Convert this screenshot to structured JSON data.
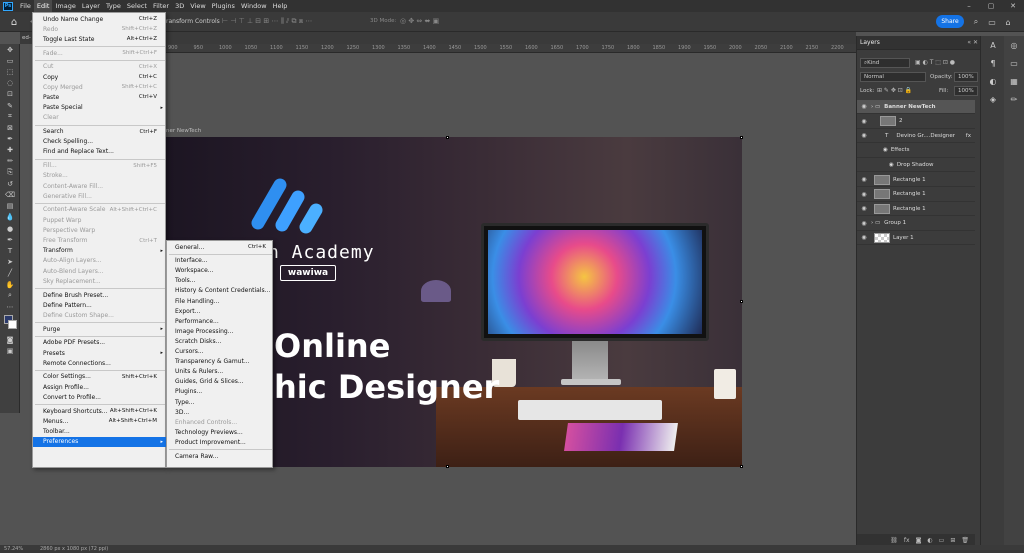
{
  "menubar": {
    "logo": "Ps",
    "items": [
      "File",
      "Edit",
      "Image",
      "Layer",
      "Type",
      "Select",
      "Filter",
      "3D",
      "View",
      "Plugins",
      "Window",
      "Help"
    ],
    "active": "Edit"
  },
  "options": {
    "transform_controls": "ransform Controls",
    "mode_3d": "3D Mode:",
    "share": "Share"
  },
  "doc_tab_label": "ed-",
  "ruler_ticks": [
    "900",
    "950",
    "1000",
    "1050",
    "1100",
    "1150",
    "1200",
    "1250",
    "1300",
    "1350",
    "1400",
    "1450",
    "1500",
    "1550",
    "1600",
    "1650",
    "1700",
    "1750",
    "1800",
    "1850",
    "1900",
    "1950",
    "2000",
    "2050",
    "2100",
    "2150",
    "2200"
  ],
  "edit_menu": [
    {
      "label": "Undo Name Change",
      "shortcut": "Ctrl+Z",
      "disabled": false
    },
    {
      "label": "Redo",
      "shortcut": "Shift+Ctrl+Z",
      "disabled": true
    },
    {
      "label": "Toggle Last State",
      "shortcut": "Alt+Ctrl+Z",
      "disabled": false
    },
    {
      "sep": true
    },
    {
      "label": "Fade...",
      "shortcut": "Shift+Ctrl+F",
      "disabled": true
    },
    {
      "sep": true
    },
    {
      "label": "Cut",
      "shortcut": "Ctrl+X",
      "disabled": true
    },
    {
      "label": "Copy",
      "shortcut": "Ctrl+C",
      "disabled": false
    },
    {
      "label": "Copy Merged",
      "shortcut": "Shift+Ctrl+C",
      "disabled": true
    },
    {
      "label": "Paste",
      "shortcut": "Ctrl+V",
      "disabled": false
    },
    {
      "label": "Paste Special",
      "shortcut": "",
      "disabled": false,
      "sub": true
    },
    {
      "label": "Clear",
      "shortcut": "",
      "disabled": true
    },
    {
      "sep": true
    },
    {
      "label": "Search",
      "shortcut": "Ctrl+F",
      "disabled": false
    },
    {
      "label": "Check Spelling...",
      "shortcut": "",
      "disabled": false
    },
    {
      "label": "Find and Replace Text...",
      "shortcut": "",
      "disabled": false
    },
    {
      "sep": true
    },
    {
      "label": "Fill...",
      "shortcut": "Shift+F5",
      "disabled": true
    },
    {
      "label": "Stroke...",
      "shortcut": "",
      "disabled": true
    },
    {
      "label": "Content-Aware Fill...",
      "shortcut": "",
      "disabled": true
    },
    {
      "label": "Generative Fill...",
      "shortcut": "",
      "disabled": true
    },
    {
      "sep": true
    },
    {
      "label": "Content-Aware Scale",
      "shortcut": "Alt+Shift+Ctrl+C",
      "disabled": true
    },
    {
      "label": "Puppet Warp",
      "shortcut": "",
      "disabled": true
    },
    {
      "label": "Perspective Warp",
      "shortcut": "",
      "disabled": true
    },
    {
      "label": "Free Transform",
      "shortcut": "Ctrl+T",
      "disabled": true
    },
    {
      "label": "Transform",
      "shortcut": "",
      "disabled": false,
      "sub": true
    },
    {
      "label": "Auto-Align Layers...",
      "shortcut": "",
      "disabled": true
    },
    {
      "label": "Auto-Blend Layers...",
      "shortcut": "",
      "disabled": true
    },
    {
      "label": "Sky Replacement...",
      "shortcut": "",
      "disabled": true
    },
    {
      "sep": true
    },
    {
      "label": "Define Brush Preset...",
      "shortcut": "",
      "disabled": false
    },
    {
      "label": "Define Pattern...",
      "shortcut": "",
      "disabled": false
    },
    {
      "label": "Define Custom Shape...",
      "shortcut": "",
      "disabled": true
    },
    {
      "sep": true
    },
    {
      "label": "Purge",
      "shortcut": "",
      "disabled": false,
      "sub": true
    },
    {
      "sep": true
    },
    {
      "label": "Adobe PDF Presets...",
      "shortcut": "",
      "disabled": false
    },
    {
      "label": "Presets",
      "shortcut": "",
      "disabled": false,
      "sub": true
    },
    {
      "label": "Remote Connections...",
      "shortcut": "",
      "disabled": false
    },
    {
      "sep": true
    },
    {
      "label": "Color Settings...",
      "shortcut": "Shift+Ctrl+K",
      "disabled": false
    },
    {
      "label": "Assign Profile...",
      "shortcut": "",
      "disabled": false
    },
    {
      "label": "Convert to Profile...",
      "shortcut": "",
      "disabled": false
    },
    {
      "sep": true
    },
    {
      "label": "Keyboard Shortcuts...",
      "shortcut": "Alt+Shift+Ctrl+K",
      "disabled": false
    },
    {
      "label": "Menus...",
      "shortcut": "Alt+Shift+Ctrl+M",
      "disabled": false
    },
    {
      "label": "Toolbar...",
      "shortcut": "",
      "disabled": false
    },
    {
      "label": "Preferences",
      "shortcut": "",
      "disabled": false,
      "sub": true,
      "highlight": true
    }
  ],
  "prefs_menu": [
    {
      "label": "General...",
      "shortcut": "Ctrl+K",
      "disabled": false
    },
    {
      "sep": true
    },
    {
      "label": "Interface...",
      "disabled": false
    },
    {
      "label": "Workspace...",
      "disabled": false
    },
    {
      "label": "Tools...",
      "disabled": false
    },
    {
      "label": "History & Content Credentials...",
      "disabled": false
    },
    {
      "label": "File Handling...",
      "disabled": false
    },
    {
      "label": "Export...",
      "disabled": false
    },
    {
      "label": "Performance...",
      "disabled": false
    },
    {
      "label": "Image Processing...",
      "disabled": false
    },
    {
      "label": "Scratch Disks...",
      "disabled": false
    },
    {
      "label": "Cursors...",
      "disabled": false
    },
    {
      "label": "Transparency & Gamut...",
      "disabled": false
    },
    {
      "label": "Units & Rulers...",
      "disabled": false
    },
    {
      "label": "Guides, Grid & Slices...",
      "disabled": false
    },
    {
      "label": "Plugins...",
      "disabled": false
    },
    {
      "label": "Type...",
      "disabled": false
    },
    {
      "label": "3D...",
      "disabled": false
    },
    {
      "label": "Enhanced Controls...",
      "disabled": true
    },
    {
      "label": "Technology Previews...",
      "disabled": false
    },
    {
      "label": "Product Improvement...",
      "disabled": false
    },
    {
      "sep": true
    },
    {
      "label": "Camera Raw...",
      "disabled": false
    }
  ],
  "artwork": {
    "layer_label": "ner NewTech",
    "academy": "n Academy",
    "brand": "wawiwa",
    "headline1": "Online",
    "headline2": "hic Designer"
  },
  "layers_panel": {
    "tab": "Layers",
    "kind": "Kind",
    "blend": "Normal",
    "opacity_label": "Opacity:",
    "opacity": "100%",
    "lock_label": "Lock:",
    "fill_label": "Fill:",
    "fill": "100%",
    "layers": [
      {
        "name": "Banner NewTech",
        "type": "group",
        "selected": true,
        "indent": 0
      },
      {
        "name": "2",
        "type": "image",
        "indent": 1
      },
      {
        "name": "Devino Gr....Designer",
        "type": "text",
        "indent": 1,
        "fx": "fx"
      },
      {
        "name": "Effects",
        "type": "effects",
        "indent": 2
      },
      {
        "name": "Drop Shadow",
        "type": "effect",
        "indent": 3
      },
      {
        "name": "Rectangle 1",
        "type": "image",
        "indent": 0
      },
      {
        "name": "Rectangle 1",
        "type": "image",
        "indent": 0
      },
      {
        "name": "Rectangle 1",
        "type": "image",
        "indent": 0
      },
      {
        "name": "Group 1",
        "type": "group",
        "indent": 0
      },
      {
        "name": "Layer 1",
        "type": "checker",
        "indent": 0
      }
    ]
  },
  "status": {
    "zoom": "57.24%",
    "doc_info": "2860 px x 1080 px (72 ppi)"
  }
}
